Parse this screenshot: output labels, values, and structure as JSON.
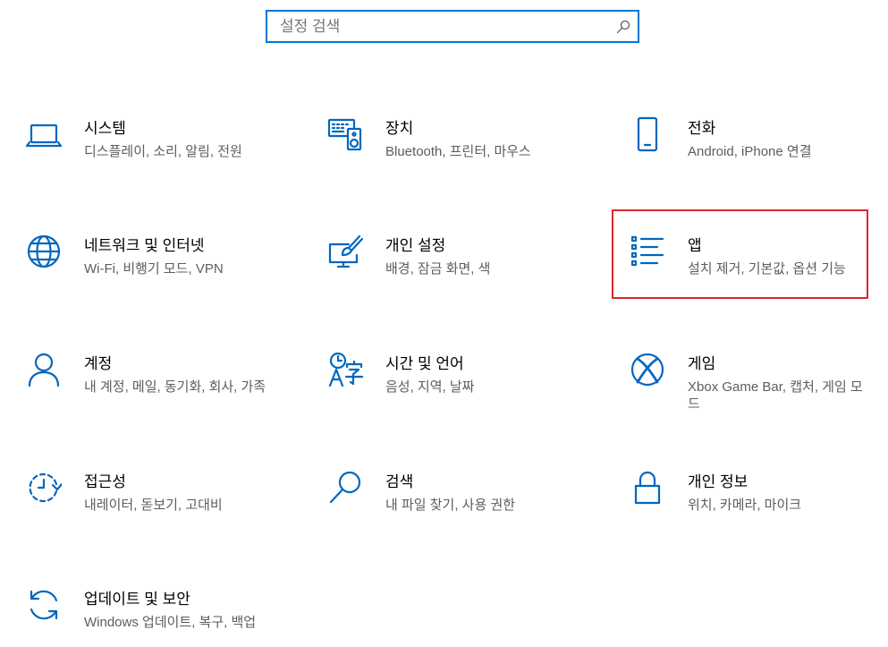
{
  "search": {
    "placeholder": "설정 검색",
    "icon": "search-icon"
  },
  "colors": {
    "accent": "#0067c0",
    "search_border": "#0078d7",
    "highlight": "#d9272e",
    "title_text": "#000000",
    "subtitle_text": "#5d5d5d",
    "background": "#ffffff"
  },
  "tiles": [
    {
      "title": "시스템",
      "subtitle": "디스플레이, 소리, 알림, 전원",
      "icon": "laptop-icon"
    },
    {
      "title": "장치",
      "subtitle": "Bluetooth, 프린터, 마우스",
      "icon": "devices-icon"
    },
    {
      "title": "전화",
      "subtitle": "Android, iPhone 연결",
      "icon": "phone-icon"
    },
    {
      "title": "네트워크 및 인터넷",
      "subtitle": "Wi-Fi, 비행기 모드, VPN",
      "icon": "globe-icon"
    },
    {
      "title": "개인 설정",
      "subtitle": "배경, 잠금 화면, 색",
      "icon": "personalization-icon"
    },
    {
      "title": "앱",
      "subtitle": "설치 제거, 기본값, 옵션 기능",
      "icon": "apps-list-icon",
      "highlighted": true
    },
    {
      "title": "계정",
      "subtitle": "내 계정, 메일, 동기화, 회사, 가족",
      "icon": "person-icon"
    },
    {
      "title": "시간 및 언어",
      "subtitle": "음성, 지역, 날짜",
      "icon": "time-language-icon"
    },
    {
      "title": "게임",
      "subtitle": "Xbox Game Bar, 캡처, 게임 모드",
      "icon": "xbox-icon"
    },
    {
      "title": "접근성",
      "subtitle": "내레이터, 돋보기, 고대비",
      "icon": "ease-of-access-icon"
    },
    {
      "title": "검색",
      "subtitle": "내 파일 찾기, 사용 권한",
      "icon": "search-icon"
    },
    {
      "title": "개인 정보",
      "subtitle": "위치, 카메라, 마이크",
      "icon": "lock-icon"
    },
    {
      "title": "업데이트 및 보안",
      "subtitle": "Windows 업데이트, 복구, 백업",
      "icon": "sync-icon"
    }
  ]
}
